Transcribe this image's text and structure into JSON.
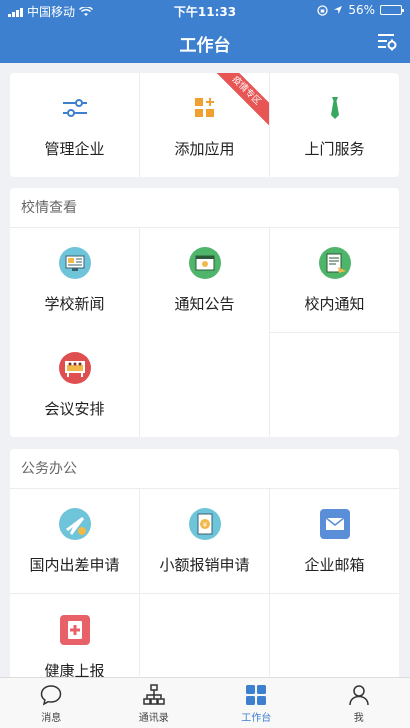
{
  "status": {
    "carrier": "中国移动",
    "time": "下午11:33",
    "battery": "56%"
  },
  "header": {
    "title": "工作台"
  },
  "top_section": {
    "items": [
      {
        "label": "管理企业",
        "icon": "sliders-icon"
      },
      {
        "label": "添加应用",
        "icon": "grid-plus-icon",
        "ribbon": "疫情专区"
      },
      {
        "label": "上门服务",
        "icon": "tie-icon"
      }
    ]
  },
  "school_section": {
    "title": "校情查看",
    "items": [
      {
        "label": "学校新闻",
        "icon": "news-icon"
      },
      {
        "label": "通知公告",
        "icon": "notice-board-icon"
      },
      {
        "label": "校内通知",
        "icon": "school-notice-icon"
      },
      {
        "label": "会议安排",
        "icon": "meeting-icon"
      }
    ]
  },
  "office_section": {
    "title": "公务办公",
    "items": [
      {
        "label": "国内出差申请",
        "icon": "airplane-icon"
      },
      {
        "label": "小额报销申请",
        "icon": "reimbursement-icon"
      },
      {
        "label": "企业邮箱",
        "icon": "mail-icon"
      },
      {
        "label": "健康上报",
        "icon": "health-icon"
      }
    ]
  },
  "tabbar": {
    "tabs": [
      {
        "label": "消息"
      },
      {
        "label": "通讯录"
      },
      {
        "label": "工作台"
      },
      {
        "label": "我"
      }
    ]
  },
  "colors": {
    "brand": "#3d80d0",
    "ribbon": "#e85555"
  }
}
